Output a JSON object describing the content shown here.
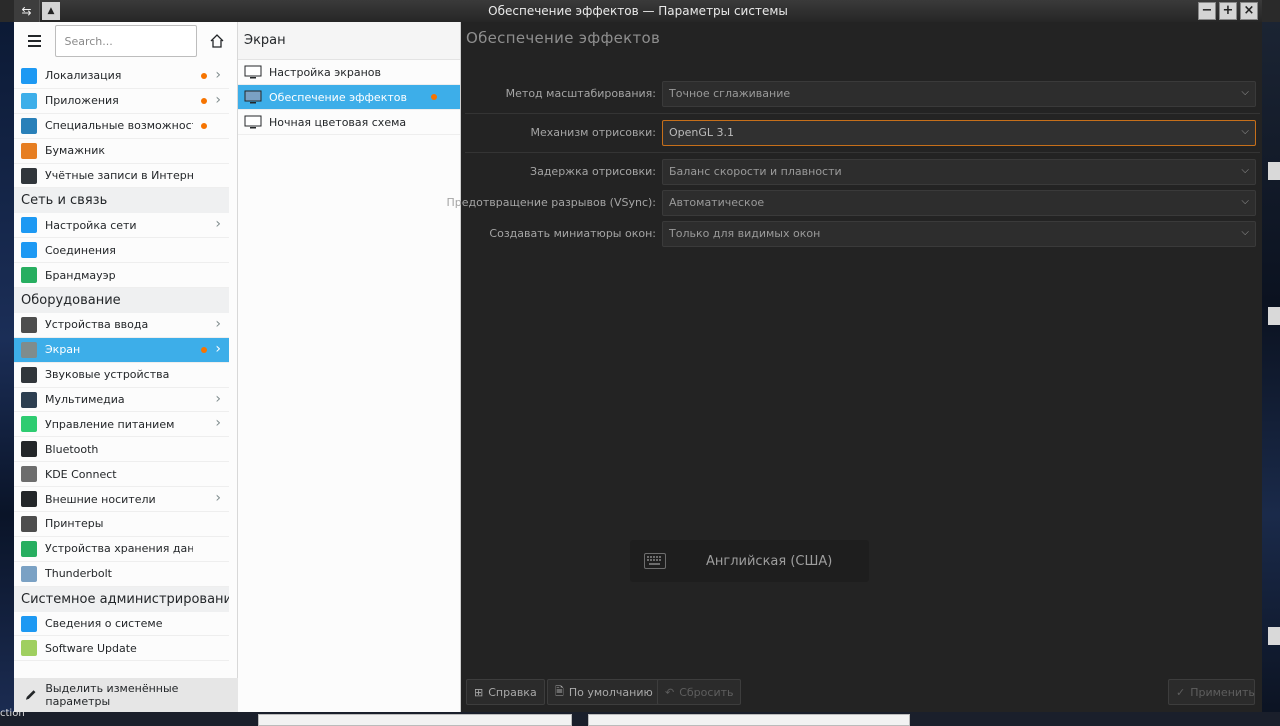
{
  "window": {
    "title": "Обеспечение эффектов — Параметры системы"
  },
  "sidebar": {
    "search_placeholder": "Search...",
    "items": [
      {
        "type": "item",
        "label": "Локализация",
        "color": "#1d99f3",
        "dot": true,
        "chevron": true
      },
      {
        "type": "item",
        "label": "Приложения",
        "color": "#3daee9",
        "dot": true,
        "chevron": true
      },
      {
        "type": "item",
        "label": "Специальные возможности",
        "color": "#2980b9",
        "dot": true,
        "chevron": false
      },
      {
        "type": "item",
        "label": "Бумажник",
        "color": "#e67e22",
        "dot": false,
        "chevron": false
      },
      {
        "type": "item",
        "label": "Учётные записи в Интернете",
        "color": "#31363b",
        "dot": false,
        "chevron": false
      },
      {
        "type": "category",
        "label": "Сеть и связь"
      },
      {
        "type": "item",
        "label": "Настройка сети",
        "color": "#1d99f3",
        "dot": false,
        "chevron": true
      },
      {
        "type": "item",
        "label": "Соединения",
        "color": "#1d99f3",
        "dot": false,
        "chevron": false
      },
      {
        "type": "item",
        "label": "Брандмауэр",
        "color": "#27ae60",
        "dot": false,
        "chevron": false
      },
      {
        "type": "category",
        "label": "Оборудование"
      },
      {
        "type": "item",
        "label": "Устройства ввода",
        "color": "#4d4d4d",
        "dot": false,
        "chevron": true
      },
      {
        "type": "item",
        "label": "Экран",
        "color": "#7f8c8d",
        "dot": true,
        "chevron": true,
        "selected": true
      },
      {
        "type": "item",
        "label": "Звуковые устройства",
        "color": "#31363b",
        "dot": false,
        "chevron": false
      },
      {
        "type": "item",
        "label": "Мультимедиа",
        "color": "#2c3e50",
        "dot": false,
        "chevron": true
      },
      {
        "type": "item",
        "label": "Управление питанием",
        "color": "#2ecc71",
        "dot": false,
        "chevron": true
      },
      {
        "type": "item",
        "label": "Bluetooth",
        "color": "#232629",
        "dot": false,
        "chevron": false
      },
      {
        "type": "item",
        "label": "KDE Connect",
        "color": "#6d6d6d",
        "dot": false,
        "chevron": false
      },
      {
        "type": "item",
        "label": "Внешние носители",
        "color": "#232629",
        "dot": false,
        "chevron": true
      },
      {
        "type": "item",
        "label": "Принтеры",
        "color": "#4d4d4d",
        "dot": false,
        "chevron": false
      },
      {
        "type": "item",
        "label": "Устройства хранения данных",
        "color": "#27ae60",
        "dot": false,
        "chevron": false
      },
      {
        "type": "item",
        "label": "Thunderbolt",
        "color": "#7aa1c4",
        "dot": false,
        "chevron": false
      },
      {
        "type": "category",
        "label": "Системное администрирование"
      },
      {
        "type": "item",
        "label": "Сведения о системе",
        "color": "#1d99f3",
        "dot": false,
        "chevron": false
      },
      {
        "type": "item",
        "label": "Software Update",
        "color": "#9fcf5f",
        "dot": false,
        "chevron": false
      }
    ],
    "footer_label": "Выделить изменённые параметры"
  },
  "subpane": {
    "title": "Экран",
    "items": [
      {
        "label": "Настройка экранов",
        "selected": false,
        "dot": false
      },
      {
        "label": "Обеспечение эффектов",
        "selected": true,
        "dot": true
      },
      {
        "label": "Ночная цветовая схема",
        "selected": false,
        "dot": false
      }
    ]
  },
  "main": {
    "title": "Обеспечение эффектов",
    "scale_label": "Метод масштабирования:",
    "scale_value": "Точное сглаживание",
    "renderer_label": "Механизм отрисовки:",
    "renderer_value": "OpenGL 3.1",
    "latency_label": "Задержка отрисовки:",
    "latency_value": "Баланс скорости и плавности",
    "vsync_label": "Предотвращение разрывов (VSync):",
    "vsync_value": "Автоматическое",
    "thumbs_label": "Создавать миниатюры окон:",
    "thumbs_value": "Только для видимых окон",
    "osd_text": "Английская (США)",
    "buttons": {
      "help": "Справка",
      "defaults": "По умолчанию",
      "reset": "Сбросить",
      "apply": "Применить"
    }
  },
  "desktop": {
    "left_text": "ction"
  }
}
